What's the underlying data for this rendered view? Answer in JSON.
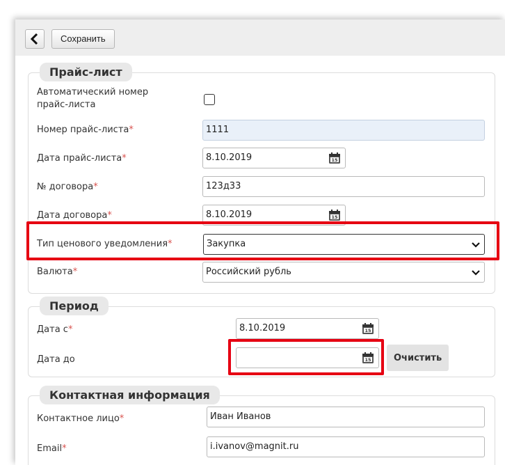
{
  "toolbar": {
    "save_label": "Сохранить"
  },
  "price_list": {
    "legend": "Прайс-лист",
    "auto_number_label": "Автоматический номер прайс-листа",
    "auto_number_checked": false,
    "number_label": "Номер прайс-листа",
    "number_value": "1111",
    "date_label": "Дата прайс-листа",
    "date_value": "8.10.2019",
    "contract_no_label": "№ договора",
    "contract_no_value": "123д33",
    "contract_date_label": "Дата договора",
    "contract_date_value": "8.10.2019",
    "notice_type_label": "Тип ценового уведомления",
    "notice_type_value": "Закупка",
    "currency_label": "Валюта",
    "currency_value": "Российский рубль"
  },
  "period": {
    "legend": "Период",
    "date_from_label": "Дата с",
    "date_from_value": "8.10.2019",
    "date_to_label": "Дата до",
    "date_to_value": "",
    "clear_label": "Очистить"
  },
  "contact": {
    "legend": "Контактная информация",
    "person_label": "Контактное лицо",
    "person_value": "Иван Иванов",
    "email_label": "Email",
    "email_value": "i.ivanov@magnit.ru"
  },
  "required_mark": "*",
  "colors": {
    "required": "#d9534f",
    "highlight": "#e60012",
    "readonly_bg": "#e9f0f9",
    "legend_bg": "#e8e8e8"
  },
  "icons": {
    "back": "chevron-left-icon",
    "calendar": "calendar-icon",
    "dropdown": "chevron-down-icon"
  }
}
